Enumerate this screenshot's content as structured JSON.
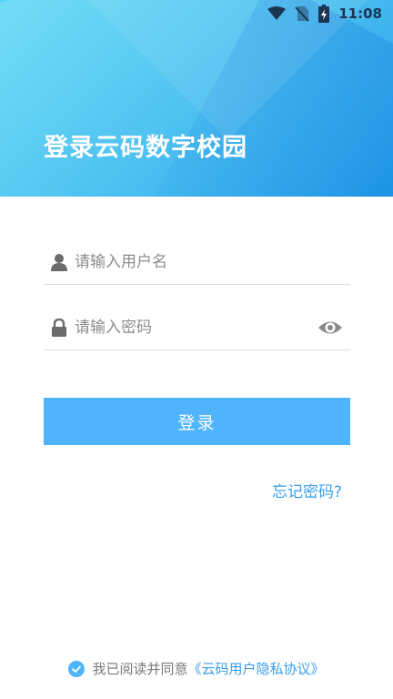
{
  "status_bar": {
    "time": "11:08",
    "icons": [
      "wifi-icon",
      "no-sim-icon",
      "battery-icon"
    ]
  },
  "header": {
    "title": "登录云码数字校园",
    "gradient": [
      "#55d6f4",
      "#1f9ae9"
    ]
  },
  "form": {
    "username_placeholder": "请输入用户名",
    "password_placeholder": "请输入密码",
    "login_label": "登录",
    "forgot_label": "忘记密码?"
  },
  "agreement": {
    "text": "我已阅读并同意",
    "link_text": "《云码用户隐私协议》"
  },
  "colors": {
    "accent": "#4fb4fb",
    "link": "#3a9eea"
  }
}
